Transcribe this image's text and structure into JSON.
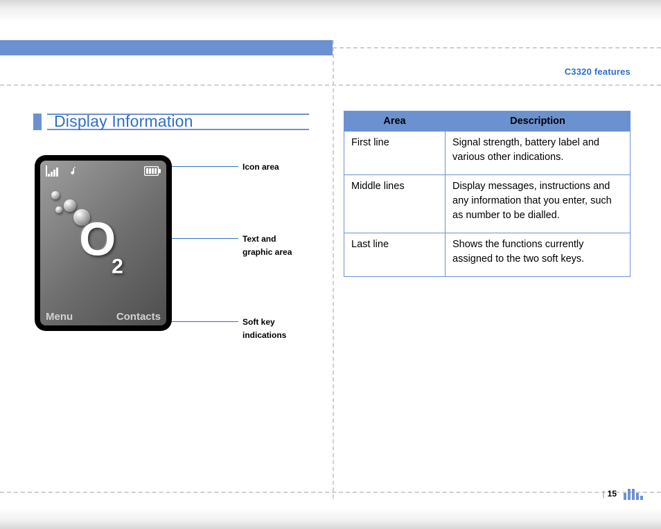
{
  "header": {
    "title_right": "C3320 features"
  },
  "section": {
    "title": "Display Information"
  },
  "phone": {
    "softkeys": {
      "left": "Menu",
      "right": "Contacts"
    },
    "logo": {
      "letter": "O",
      "subscript": "2"
    }
  },
  "callouts": {
    "icon_area": "Icon area",
    "text_area_l1": "Text and",
    "text_area_l2": "graphic area",
    "softkey_l1": "Soft key",
    "softkey_l2": "indications"
  },
  "table": {
    "headers": {
      "area": "Area",
      "desc": "Description"
    },
    "rows": [
      {
        "area": "First line",
        "desc": "Signal strength, battery label and various other indications."
      },
      {
        "area": "Middle lines",
        "desc": "Display messages, instructions and any information that you enter, such as number to be dialled."
      },
      {
        "area": "Last line",
        "desc": "Shows the functions currently assigned to the two soft keys."
      }
    ]
  },
  "footer": {
    "page": "15"
  }
}
